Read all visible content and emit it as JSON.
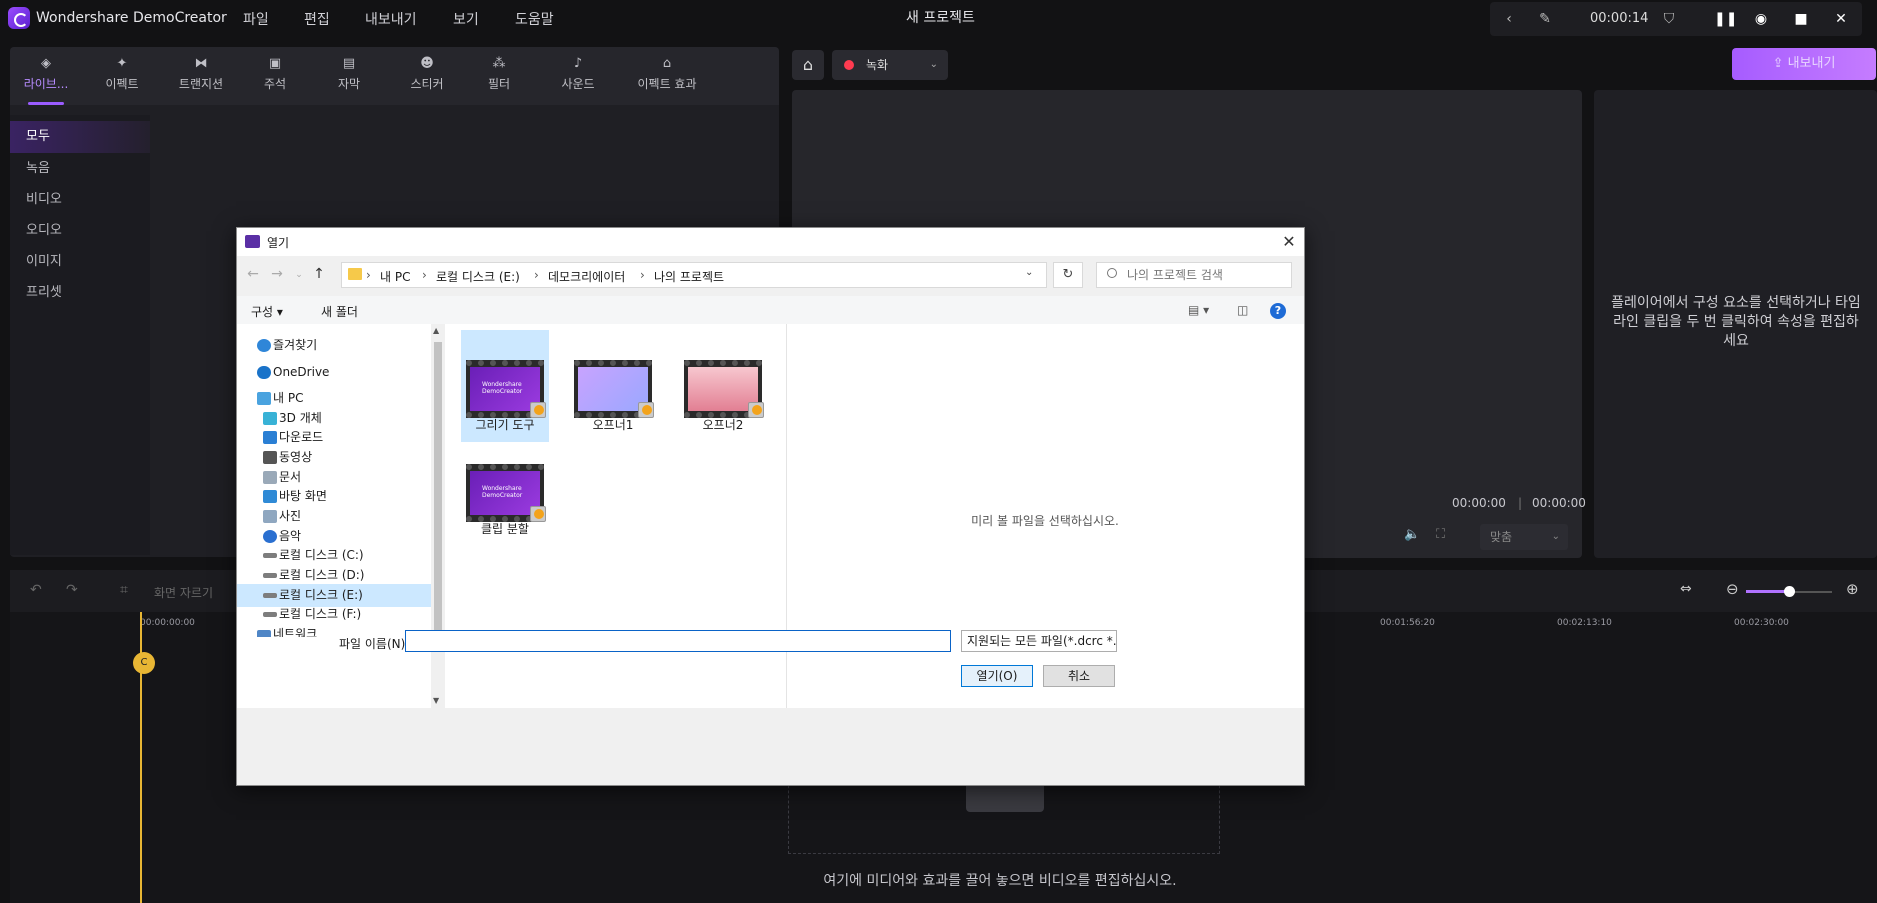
{
  "app": {
    "name": "Wondershare DemoCreator",
    "project_title": "새 프로젝트"
  },
  "menu": [
    "파일",
    "편집",
    "내보내기",
    "보기",
    "도움말"
  ],
  "recorder": {
    "time": "00:00:14"
  },
  "media_tabs": [
    {
      "label": "라이브...",
      "icon": "library-icon"
    },
    {
      "label": "이펙트",
      "icon": "effects-icon"
    },
    {
      "label": "트랜지션",
      "icon": "transition-icon"
    },
    {
      "label": "주석",
      "icon": "annotation-icon"
    },
    {
      "label": "자막",
      "icon": "caption-icon"
    },
    {
      "label": "스티커",
      "icon": "sticker-icon"
    },
    {
      "label": "필터",
      "icon": "filter-icon"
    },
    {
      "label": "사운드",
      "icon": "sound-icon"
    },
    {
      "label": "이펙트 효과",
      "icon": "effect-store-icon"
    }
  ],
  "categories": [
    "모두",
    "녹음",
    "비디오",
    "오디오",
    "이미지",
    "프리셋"
  ],
  "toolbar": {
    "record_label": "녹화",
    "export_label": "내보내기",
    "crop_label": "화면 자르기"
  },
  "preview": {
    "current_time": "00:00:00",
    "total_time": "00:00:00",
    "fit": "맞춤"
  },
  "properties": {
    "message": "플레이어에서 구성 요소를 선택하거나 타임라인 클립을 두 번 클릭하여 속성을 편집하세요"
  },
  "timeline": {
    "ticks": [
      "00:00:00:00",
      "00:01:56:20",
      "00:02:13:10",
      "00:02:30:00"
    ],
    "drop_message": "여기에 미디어와 효과를 끌어 놓으면 비디오를 편집하십시오.",
    "playhead_label": "C"
  },
  "dialog": {
    "title": "열기",
    "breadcrumb": [
      "내 PC",
      "로컬 디스크 (E:)",
      "데모크리에이터",
      "나의 프로젝트"
    ],
    "search_placeholder": "나의 프로젝트 검색",
    "organize": "구성",
    "new_folder": "새 폴더",
    "nav": [
      {
        "label": "즐겨찾기",
        "color": "#2f86d8"
      },
      {
        "label": "OneDrive",
        "color": "#1a73c9"
      },
      {
        "label": "내 PC",
        "color": "#4aa3df"
      },
      {
        "label": "3D 개체",
        "color": "#38b2d6"
      },
      {
        "label": "다운로드",
        "color": "#2a7fd4"
      },
      {
        "label": "동영상",
        "color": "#555555"
      },
      {
        "label": "문서",
        "color": "#9aa9b8"
      },
      {
        "label": "바탕 화면",
        "color": "#2f8ad6"
      },
      {
        "label": "사진",
        "color": "#8fa7c0"
      },
      {
        "label": "음악",
        "color": "#2a6fd0"
      },
      {
        "label": "로컬 디스크 (C:)",
        "color": "#7d7d7d"
      },
      {
        "label": "로컬 디스크 (D:)",
        "color": "#7d7d7d"
      },
      {
        "label": "로컬 디스크 (E:)",
        "color": "#7d7d7d"
      },
      {
        "label": "로컬 디스크 (F:)",
        "color": "#7d7d7d"
      },
      {
        "label": "네트워크",
        "color": "#4f86c6"
      }
    ],
    "files": [
      {
        "name": "그리기 도구",
        "thumb": "purple"
      },
      {
        "name": "오프너1",
        "thumb": "lilac"
      },
      {
        "name": "오프너2",
        "thumb": "pink"
      },
      {
        "name": "클립 분할",
        "thumb": "purple"
      }
    ],
    "thumb_caption": "Wondershare DemoCreator",
    "preview_message": "미리 볼 파일을 선택하십시오.",
    "filename_label": "파일 이름(N):",
    "filename_value": "",
    "filetype": "지원되는 모든 파일(*.dcrc *.mp",
    "open_label": "열기(O)",
    "cancel_label": "취소"
  }
}
